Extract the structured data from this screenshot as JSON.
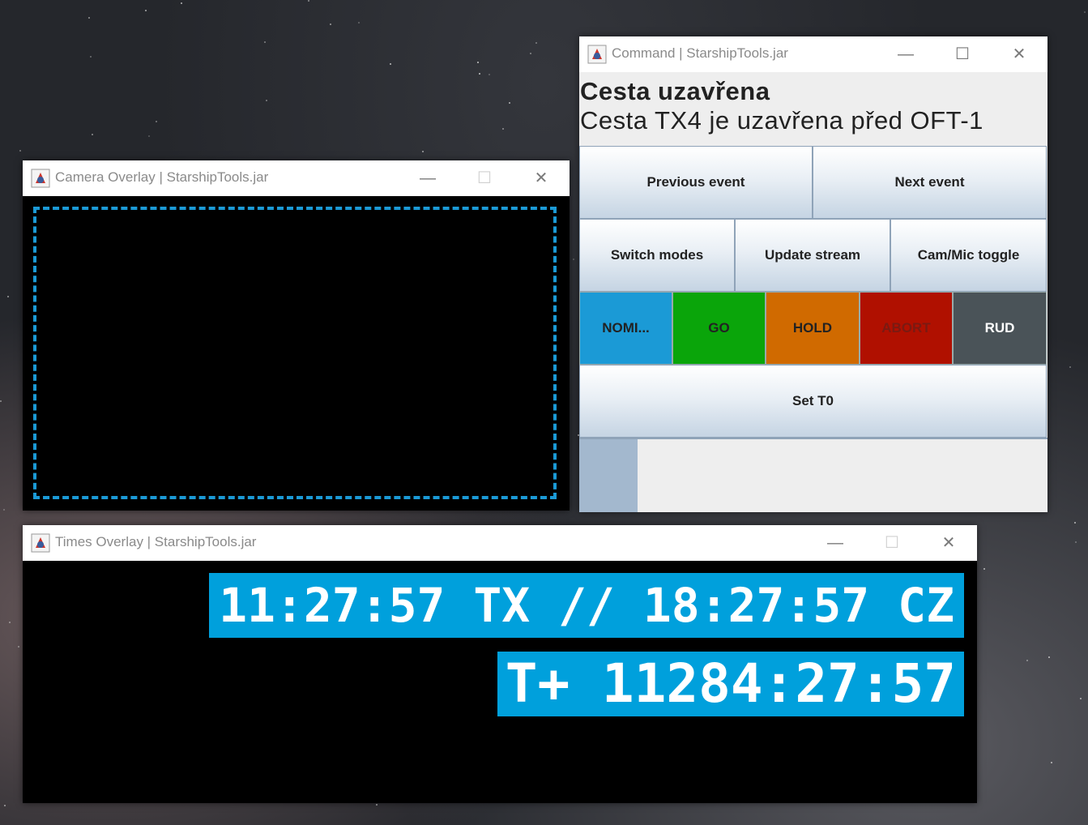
{
  "camera_window": {
    "title": "Camera Overlay | StarshipTools.jar",
    "minimize": "—",
    "maximize": "☐",
    "close": "✕"
  },
  "command_window": {
    "title": "Command | StarshipTools.jar",
    "minimize": "—",
    "maximize": "☐",
    "close": "✕",
    "event_title": "Cesta uzavřena",
    "event_description": "Cesta TX4 je uzavřena před OFT-1",
    "buttons": {
      "previous_event": "Previous event",
      "next_event": "Next event",
      "switch_modes": "Switch modes",
      "update_stream": "Update stream",
      "cam_mic_toggle": "Cam/Mic toggle",
      "set_t0": "Set T0"
    },
    "status_buttons": [
      {
        "label": "NOMI...",
        "color": "#1b9ad6",
        "text_color": "#222222"
      },
      {
        "label": "GO",
        "color": "#0aa50a",
        "text_color": "#222222"
      },
      {
        "label": "HOLD",
        "color": "#d06a00",
        "text_color": "#222222"
      },
      {
        "label": "ABORT",
        "color": "#b01000",
        "text_color": "#7a1a12"
      },
      {
        "label": "RUD",
        "color": "#4a5358",
        "text_color": "#ffffff"
      }
    ],
    "progress_fraction": 0.125
  },
  "times_window": {
    "title": "Times Overlay | StarshipTools.jar",
    "minimize": "—",
    "maximize": "☐",
    "close": "✕",
    "clock_line": "11:27:57 TX // 18:27:57 CZ",
    "countdown_line": "T+ 11284:27:57"
  },
  "colors": {
    "accent": "#00a0dc"
  }
}
